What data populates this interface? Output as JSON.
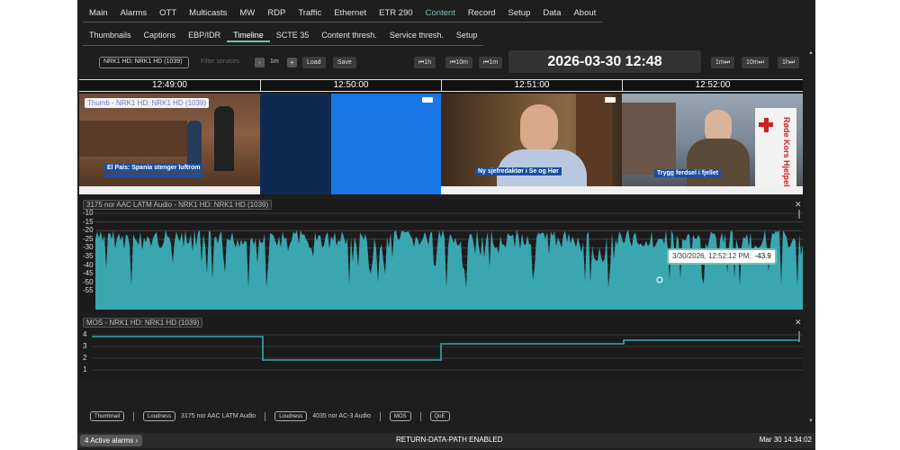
{
  "menu": {
    "items": [
      "Main",
      "Alarms",
      "OTT",
      "Multicasts",
      "MW",
      "RDP",
      "Traffic",
      "Ethernet",
      "ETR 290",
      "Content",
      "Record",
      "Setup",
      "Data",
      "About"
    ],
    "active": "Content"
  },
  "submenu": {
    "items": [
      "Thumbnails",
      "Captions",
      "EBP/IDR",
      "Timeline",
      "SCTE 35",
      "Content thresh.",
      "Service thresh.",
      "Setup"
    ],
    "active": "Timeline"
  },
  "controls": {
    "service_select": "NRK1 HD: NRK1 HD (1039)",
    "filter_placeholder": "Filter services",
    "minus": "-",
    "range": "1m",
    "plus": "+",
    "load": "Load",
    "save": "Save",
    "back_1h": "⏮1h",
    "back_10m": "⏮10m",
    "back_1m": "⏮1m",
    "clock": "2026-03-30 12:48",
    "fwd_1m": "1m⏭",
    "fwd_10m": "10m⏭",
    "fwd_1h": "1h⏭"
  },
  "timeline": {
    "times": [
      "12:49:00",
      "12:50:00",
      "12:51:00",
      "12:52:00"
    ]
  },
  "thumbnails": {
    "label": "Thumb - NRK1 HD: NRK1 HD (1039)",
    "captions": [
      "El País: Spania stenger luftrom",
      "Ny sjefredaktør i Se og Hør",
      "Trygg ferdsel i fjellet"
    ],
    "sign_text": "Røde Kors Hjelpekorps",
    "colors": {
      "blue_screen": "#1877e6",
      "dark_navy": "#0f2a52"
    }
  },
  "audio": {
    "label": "3175 nor AAC LATM Audio - NRK1 HD: NRK1 HD (1039)",
    "yticks": [
      "-10",
      "-15",
      "-20",
      "-25",
      "-30",
      "-35",
      "-40",
      "-45",
      "-50",
      "-55"
    ],
    "tooltip_time": "3/30/2026, 12:52:12 PM:",
    "tooltip_value": "-43.9",
    "color": "#3aa6b0"
  },
  "mos": {
    "label": "MOS - NRK1 HD: NRK1 HD (1039)",
    "yticks": [
      "4",
      "3",
      "2",
      "1"
    ]
  },
  "legend": {
    "thumbnail": "Thumbnail",
    "loudness1": "Loudness",
    "loudness1_txt": "3175 nor AAC LATM Audio",
    "loudness2": "Loudness",
    "loudness2_txt": "4035 nor AC-3 Audio",
    "mos": "MOS",
    "qoe": "QoE"
  },
  "status": {
    "alarms": "4 Active alarms ›",
    "center": "RETURN-DATA-PATH ENABLED",
    "right": "Mar 30 14:34:02"
  }
}
